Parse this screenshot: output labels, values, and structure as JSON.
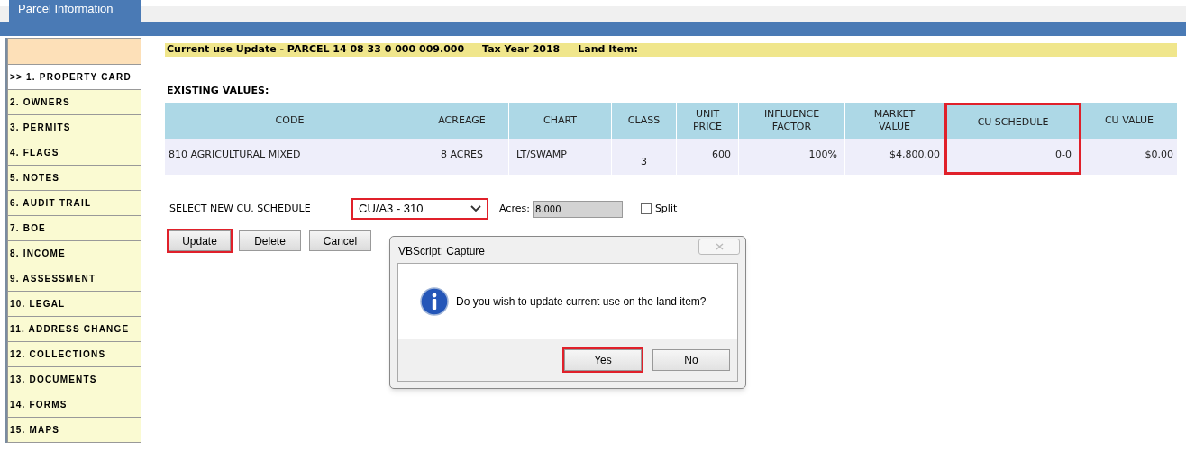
{
  "tab": {
    "label": "Parcel Information"
  },
  "sidebar": {
    "items": [
      {
        "label": ">> 1. PROPERTY CARD",
        "selected": true
      },
      {
        "label": "2. OWNERS",
        "selected": false
      },
      {
        "label": "3. PERMITS",
        "selected": false
      },
      {
        "label": "4. FLAGS",
        "selected": false
      },
      {
        "label": "5. NOTES",
        "selected": false
      },
      {
        "label": "6. AUDIT TRAIL",
        "selected": false
      },
      {
        "label": "7. BOE",
        "selected": false
      },
      {
        "label": "8. INCOME",
        "selected": false
      },
      {
        "label": "9. ASSESSMENT",
        "selected": false
      },
      {
        "label": "10. LEGAL",
        "selected": false
      },
      {
        "label": "11. ADDRESS CHANGE",
        "selected": false
      },
      {
        "label": "12. COLLECTIONS",
        "selected": false
      },
      {
        "label": "13. DOCUMENTS",
        "selected": false
      },
      {
        "label": "14. FORMS",
        "selected": false
      },
      {
        "label": "15. MAPS",
        "selected": false
      }
    ]
  },
  "header": {
    "title": "Current use Update - PARCEL 14 08 33 0 000 009.000",
    "tax_year": "Tax Year 2018",
    "land_item": "Land Item:"
  },
  "section_title": "EXISTING VALUES:",
  "table": {
    "columns": [
      {
        "label": "CODE",
        "highlighted": false
      },
      {
        "label": "ACREAGE",
        "highlighted": false
      },
      {
        "label": "CHART",
        "highlighted": false
      },
      {
        "label": "CLASS",
        "highlighted": false
      },
      {
        "label": "UNIT PRICE",
        "highlighted": false
      },
      {
        "label": "INFLUENCE FACTOR",
        "highlighted": false
      },
      {
        "label": "MARKET VALUE",
        "highlighted": false
      },
      {
        "label": "CU SCHEDULE",
        "highlighted": true
      },
      {
        "label": "CU VALUE",
        "highlighted": false
      }
    ],
    "rows": [
      {
        "cells": [
          "810 AGRICULTURAL MIXED",
          "8 ACRES",
          "LT/SWAMP",
          "3",
          "600",
          "100%",
          "$4,800.00",
          "0-0",
          "$0.00"
        ]
      }
    ]
  },
  "schedule_form": {
    "label": "SELECT NEW CU. SCHEDULE",
    "select": {
      "value": "CU/A3 - 310",
      "highlighted": true
    },
    "acres": {
      "label": "Acres:",
      "value": "8.000"
    },
    "split": {
      "label": "Split",
      "checked": false
    }
  },
  "buttons": [
    {
      "label": "Update",
      "highlighted": true
    },
    {
      "label": "Delete",
      "highlighted": false
    },
    {
      "label": "Cancel",
      "highlighted": false
    }
  ],
  "dialog": {
    "title": "VBScript: Capture",
    "message": "Do you wish to update current use on the land item?",
    "buttons": [
      {
        "label": "Yes",
        "highlighted": true
      },
      {
        "label": "No",
        "highlighted": false
      }
    ]
  }
}
